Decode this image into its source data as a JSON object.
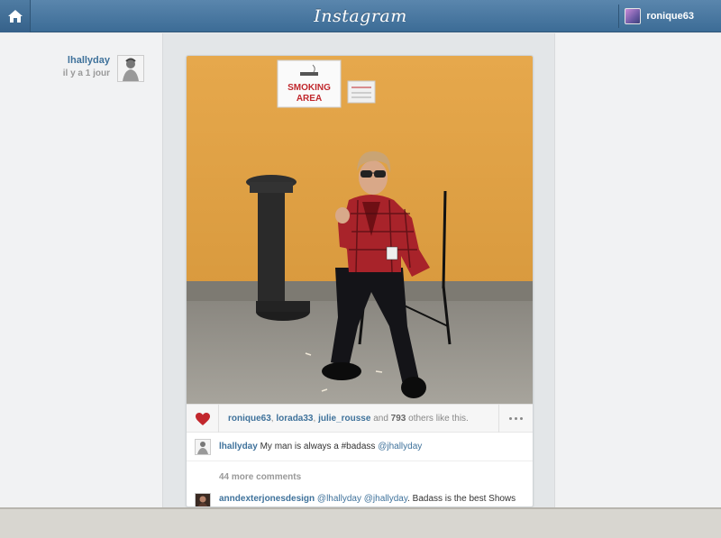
{
  "header": {
    "logo": "Instagram",
    "username": "ronique63",
    "icons": {
      "home": "home-icon",
      "avatar": "user-avatar"
    }
  },
  "post": {
    "author": "lhallyday",
    "time": "il y a 1 jour",
    "photo_sign_text": "SMOKING AREA",
    "likes": {
      "user1": "ronique63",
      "sep1": ", ",
      "user2": "lorada33",
      "sep2": ", ",
      "user3": "julie_rousse",
      "and": " and ",
      "count": "793",
      "suffix": " others like this."
    },
    "caption": {
      "author": "lhallyday",
      "text": "My man is always a #badass",
      "mention": "@jhallyday"
    },
    "more_comments": "44 more comments",
    "comment": {
      "author": "anndexterjonesdesign",
      "mention1": "@lhallyday",
      "mention2": "@jhallyday",
      "text": ". Badass is the best Shows"
    }
  },
  "colors": {
    "link": "#3f729b",
    "header": "#3c6c96",
    "heart": "#c2272d",
    "wall": "#e3a448"
  }
}
